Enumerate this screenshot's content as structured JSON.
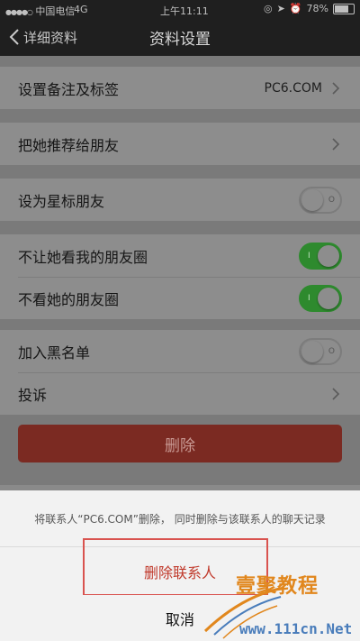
{
  "status_bar": {
    "carrier": "中国电信",
    "network": "4G",
    "time": "上午11:11",
    "battery": "78%"
  },
  "nav": {
    "back_label": "详细资料",
    "title": "资料设置"
  },
  "settings": {
    "remark_label": "设置备注及标签",
    "remark_value": "PC6.COM",
    "recommend_label": "把她推荐给朋友",
    "star_label": "设为星标朋友",
    "star_on": false,
    "hide_moments_label": "不让她看我的朋友圈",
    "hide_moments_on": true,
    "dont_see_label": "不看她的朋友圈",
    "dont_see_on": true,
    "blacklist_label": "加入黑名单",
    "blacklist_on": false,
    "report_label": "投诉",
    "delete_button": "删除"
  },
  "action_sheet": {
    "message": "将联系人“PC6.COM”删除， 同时删除与该联系人的聊天记录",
    "confirm_label": "删除联系人",
    "cancel_label": "取消"
  },
  "watermark": {
    "logo_text": "壹聚教程",
    "url": "www.111cn.Net"
  },
  "colors": {
    "toggle_on": "#2e8a2e",
    "danger": "#c0392b",
    "highlight": "#d9534f"
  }
}
